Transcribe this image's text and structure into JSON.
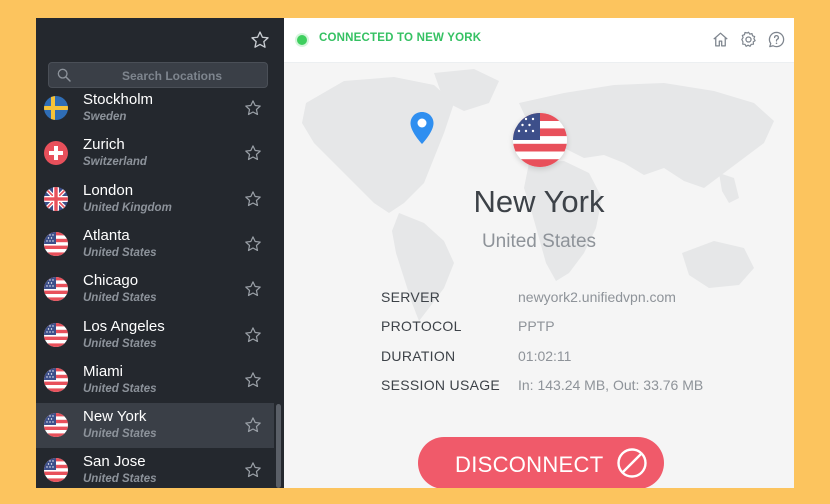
{
  "sidebar": {
    "search_placeholder": "Search Locations",
    "locations": [
      {
        "city": "Stockholm",
        "country": "Sweden",
        "flag": "sweden"
      },
      {
        "city": "Zurich",
        "country": "Switzerland",
        "flag": "switzerland"
      },
      {
        "city": "London",
        "country": "United Kingdom",
        "flag": "uk"
      },
      {
        "city": "Atlanta",
        "country": "United States",
        "flag": "us"
      },
      {
        "city": "Chicago",
        "country": "United States",
        "flag": "us"
      },
      {
        "city": "Los Angeles",
        "country": "United States",
        "flag": "us"
      },
      {
        "city": "Miami",
        "country": "United States",
        "flag": "us"
      },
      {
        "city": "New York",
        "country": "United States",
        "flag": "us",
        "selected": true
      },
      {
        "city": "San Jose",
        "country": "United States",
        "flag": "us"
      }
    ]
  },
  "header": {
    "status": "CONNECTED TO NEW YORK",
    "status_color": "#35c163",
    "icons": [
      "home-icon",
      "gear-icon",
      "help-icon"
    ]
  },
  "connection": {
    "city": "New York",
    "country": "United States",
    "details": [
      {
        "label": "SERVER",
        "value": "newyork2.unifiedvpn.com"
      },
      {
        "label": "PROTOCOL",
        "value": "PPTP"
      },
      {
        "label": "DURATION",
        "value": "01:02:11"
      },
      {
        "label": "SESSION USAGE",
        "value": "In: 143.24 MB, Out: 33.76 MB"
      }
    ],
    "disconnect_label": "DISCONNECT",
    "accent": "#f05a6a"
  }
}
